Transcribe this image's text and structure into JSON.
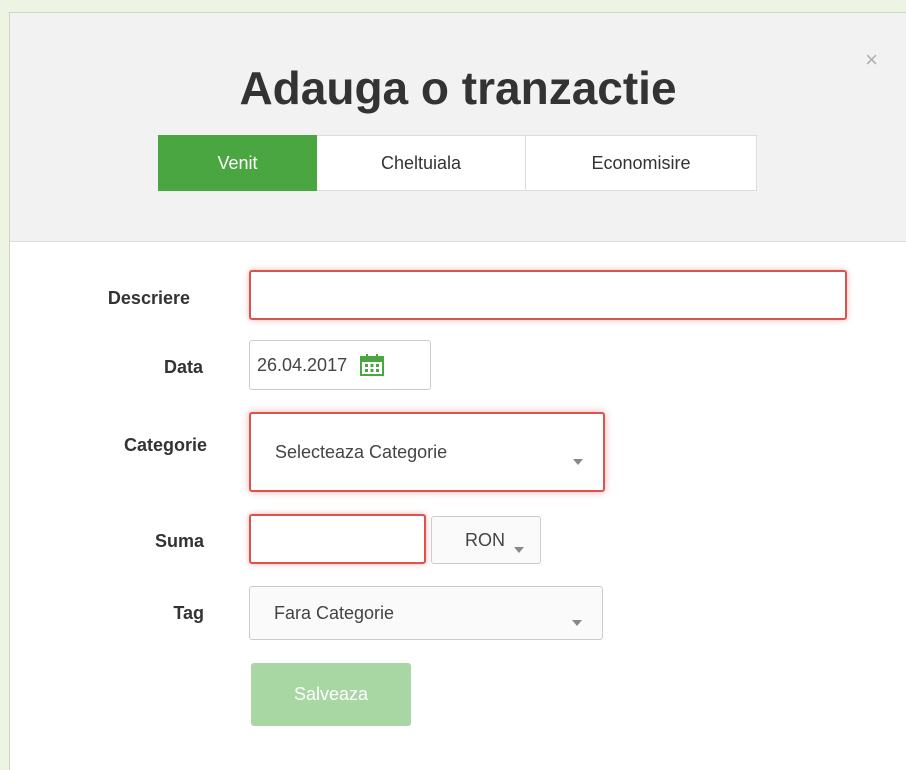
{
  "modal": {
    "title": "Adauga o tranzactie",
    "close_symbol": "×"
  },
  "tabs": [
    {
      "label": "Venit",
      "active": true
    },
    {
      "label": "Cheltuiala",
      "active": false
    },
    {
      "label": "Economisire",
      "active": false
    }
  ],
  "form": {
    "description": {
      "label": "Descriere",
      "value": "",
      "state": "error"
    },
    "date": {
      "label": "Data",
      "value": "26.04.2017",
      "icon": "calendar-icon"
    },
    "category": {
      "label": "Categorie",
      "selected": "Selecteaza Categorie",
      "state": "error"
    },
    "amount": {
      "label": "Suma",
      "value": "",
      "state": "error",
      "currency": "RON"
    },
    "tag": {
      "label": "Tag",
      "selected": "Fara Categorie"
    },
    "save_label": "Salveaza"
  },
  "colors": {
    "accent": "#4aa641",
    "error": "#d9534f",
    "disabled_button": "#a8d7a3",
    "header_bg": "#f2f2f2"
  }
}
